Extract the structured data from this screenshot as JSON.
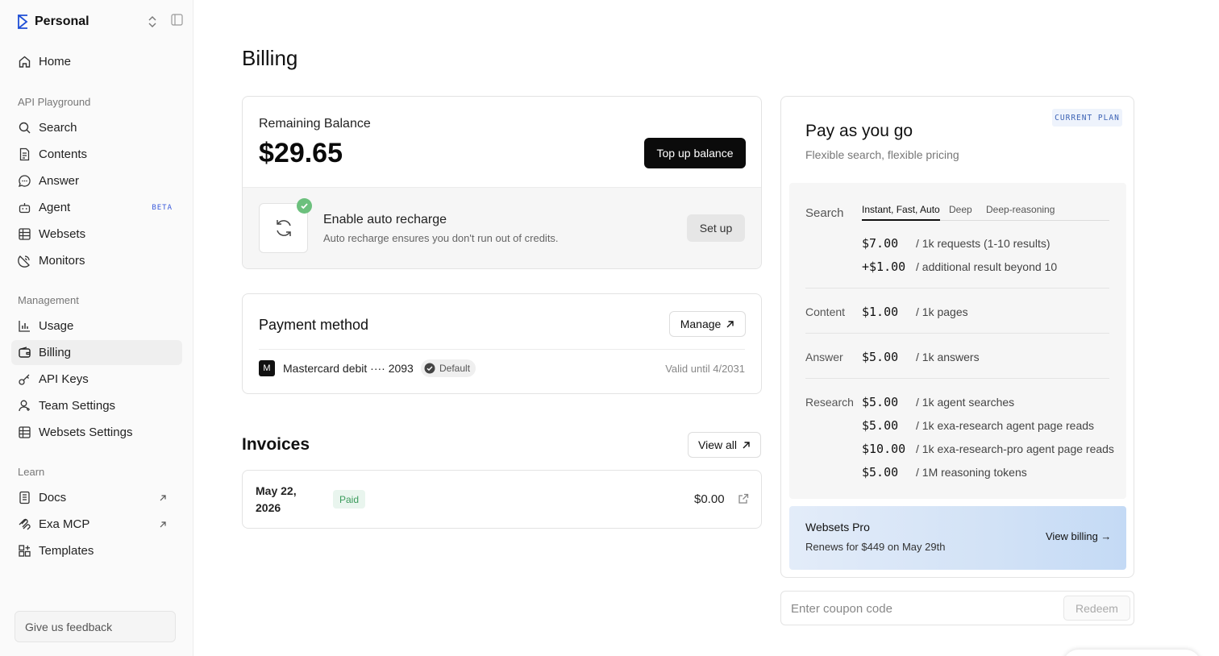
{
  "workspace": {
    "name": "Personal"
  },
  "sidebar": {
    "home": "Home",
    "api_playground_label": "API Playground",
    "api_items": [
      {
        "label": "Search",
        "icon": "search-icon"
      },
      {
        "label": "Contents",
        "icon": "document-icon"
      },
      {
        "label": "Answer",
        "icon": "chat-icon"
      },
      {
        "label": "Agent",
        "icon": "robot-icon",
        "badge": "BETA"
      },
      {
        "label": "Websets",
        "icon": "table-icon"
      },
      {
        "label": "Monitors",
        "icon": "satellite-icon"
      }
    ],
    "management_label": "Management",
    "management_items": [
      {
        "label": "Usage",
        "icon": "bar-chart-icon"
      },
      {
        "label": "Billing",
        "icon": "wallet-icon",
        "active": true
      },
      {
        "label": "API Keys",
        "icon": "key-icon"
      },
      {
        "label": "Team Settings",
        "icon": "user-icon"
      },
      {
        "label": "Websets Settings",
        "icon": "table-icon"
      }
    ],
    "learn_label": "Learn",
    "learn_items": [
      {
        "label": "Docs",
        "icon": "book-icon",
        "external": true
      },
      {
        "label": "Exa MCP",
        "icon": "mcp-icon",
        "external": true
      },
      {
        "label": "Templates",
        "icon": "templates-icon"
      }
    ],
    "feedback": "Give us feedback"
  },
  "page": {
    "title": "Billing"
  },
  "balance": {
    "label": "Remaining Balance",
    "amount": "$29.65",
    "top_up": "Top up balance",
    "auto_recharge_title": "Enable auto recharge",
    "auto_recharge_sub": "Auto recharge ensures you don't run out of credits.",
    "setup": "Set up"
  },
  "payment": {
    "title": "Payment method",
    "manage": "Manage",
    "card_logo": "M",
    "card_name": "Mastercard debit ···· 2093",
    "default": "Default",
    "valid": "Valid until 4/2031"
  },
  "invoices": {
    "title": "Invoices",
    "view_all": "View all",
    "rows": [
      {
        "date": "May 22, 2026",
        "status": "Paid",
        "amount": "$0.00"
      }
    ]
  },
  "plan": {
    "badge": "CURRENT PLAN",
    "title": "Pay as you go",
    "subtitle": "Flexible search, flexible pricing",
    "search_label": "Search",
    "tabs": [
      "Instant, Fast, Auto",
      "Deep",
      "Deep-reasoning"
    ],
    "active_tab": "Instant, Fast, Auto",
    "search_rows": [
      {
        "price": "$7.00",
        "desc": "/ 1k requests (1-10 results)"
      },
      {
        "price": "+$1.00",
        "desc": "/ additional result beyond 10"
      }
    ],
    "content_label": "Content",
    "content_row": {
      "price": "$1.00",
      "desc": "/ 1k pages"
    },
    "answer_label": "Answer",
    "answer_row": {
      "price": "$5.00",
      "desc": "/ 1k answers"
    },
    "research_label": "Research",
    "research_rows": [
      {
        "price": "$5.00",
        "desc": "/ 1k agent searches"
      },
      {
        "price": "$5.00",
        "desc": "/ 1k exa-research agent page reads"
      },
      {
        "price": "$10.00",
        "desc": "/ 1k exa-research-pro agent page reads"
      },
      {
        "price": "$5.00",
        "desc": "/ 1M reasoning tokens"
      }
    ],
    "websets_pro": {
      "title": "Websets Pro",
      "renews": "Renews for $449 on May 29th",
      "view_billing": "View billing →"
    }
  },
  "coupon": {
    "placeholder": "Enter coupon code",
    "redeem": "Redeem"
  },
  "colors": {
    "accent": "#3b5bdb",
    "success": "#6cc07d",
    "paid_text": "#3a9a5b",
    "dark_button": "#0b0b0b"
  }
}
